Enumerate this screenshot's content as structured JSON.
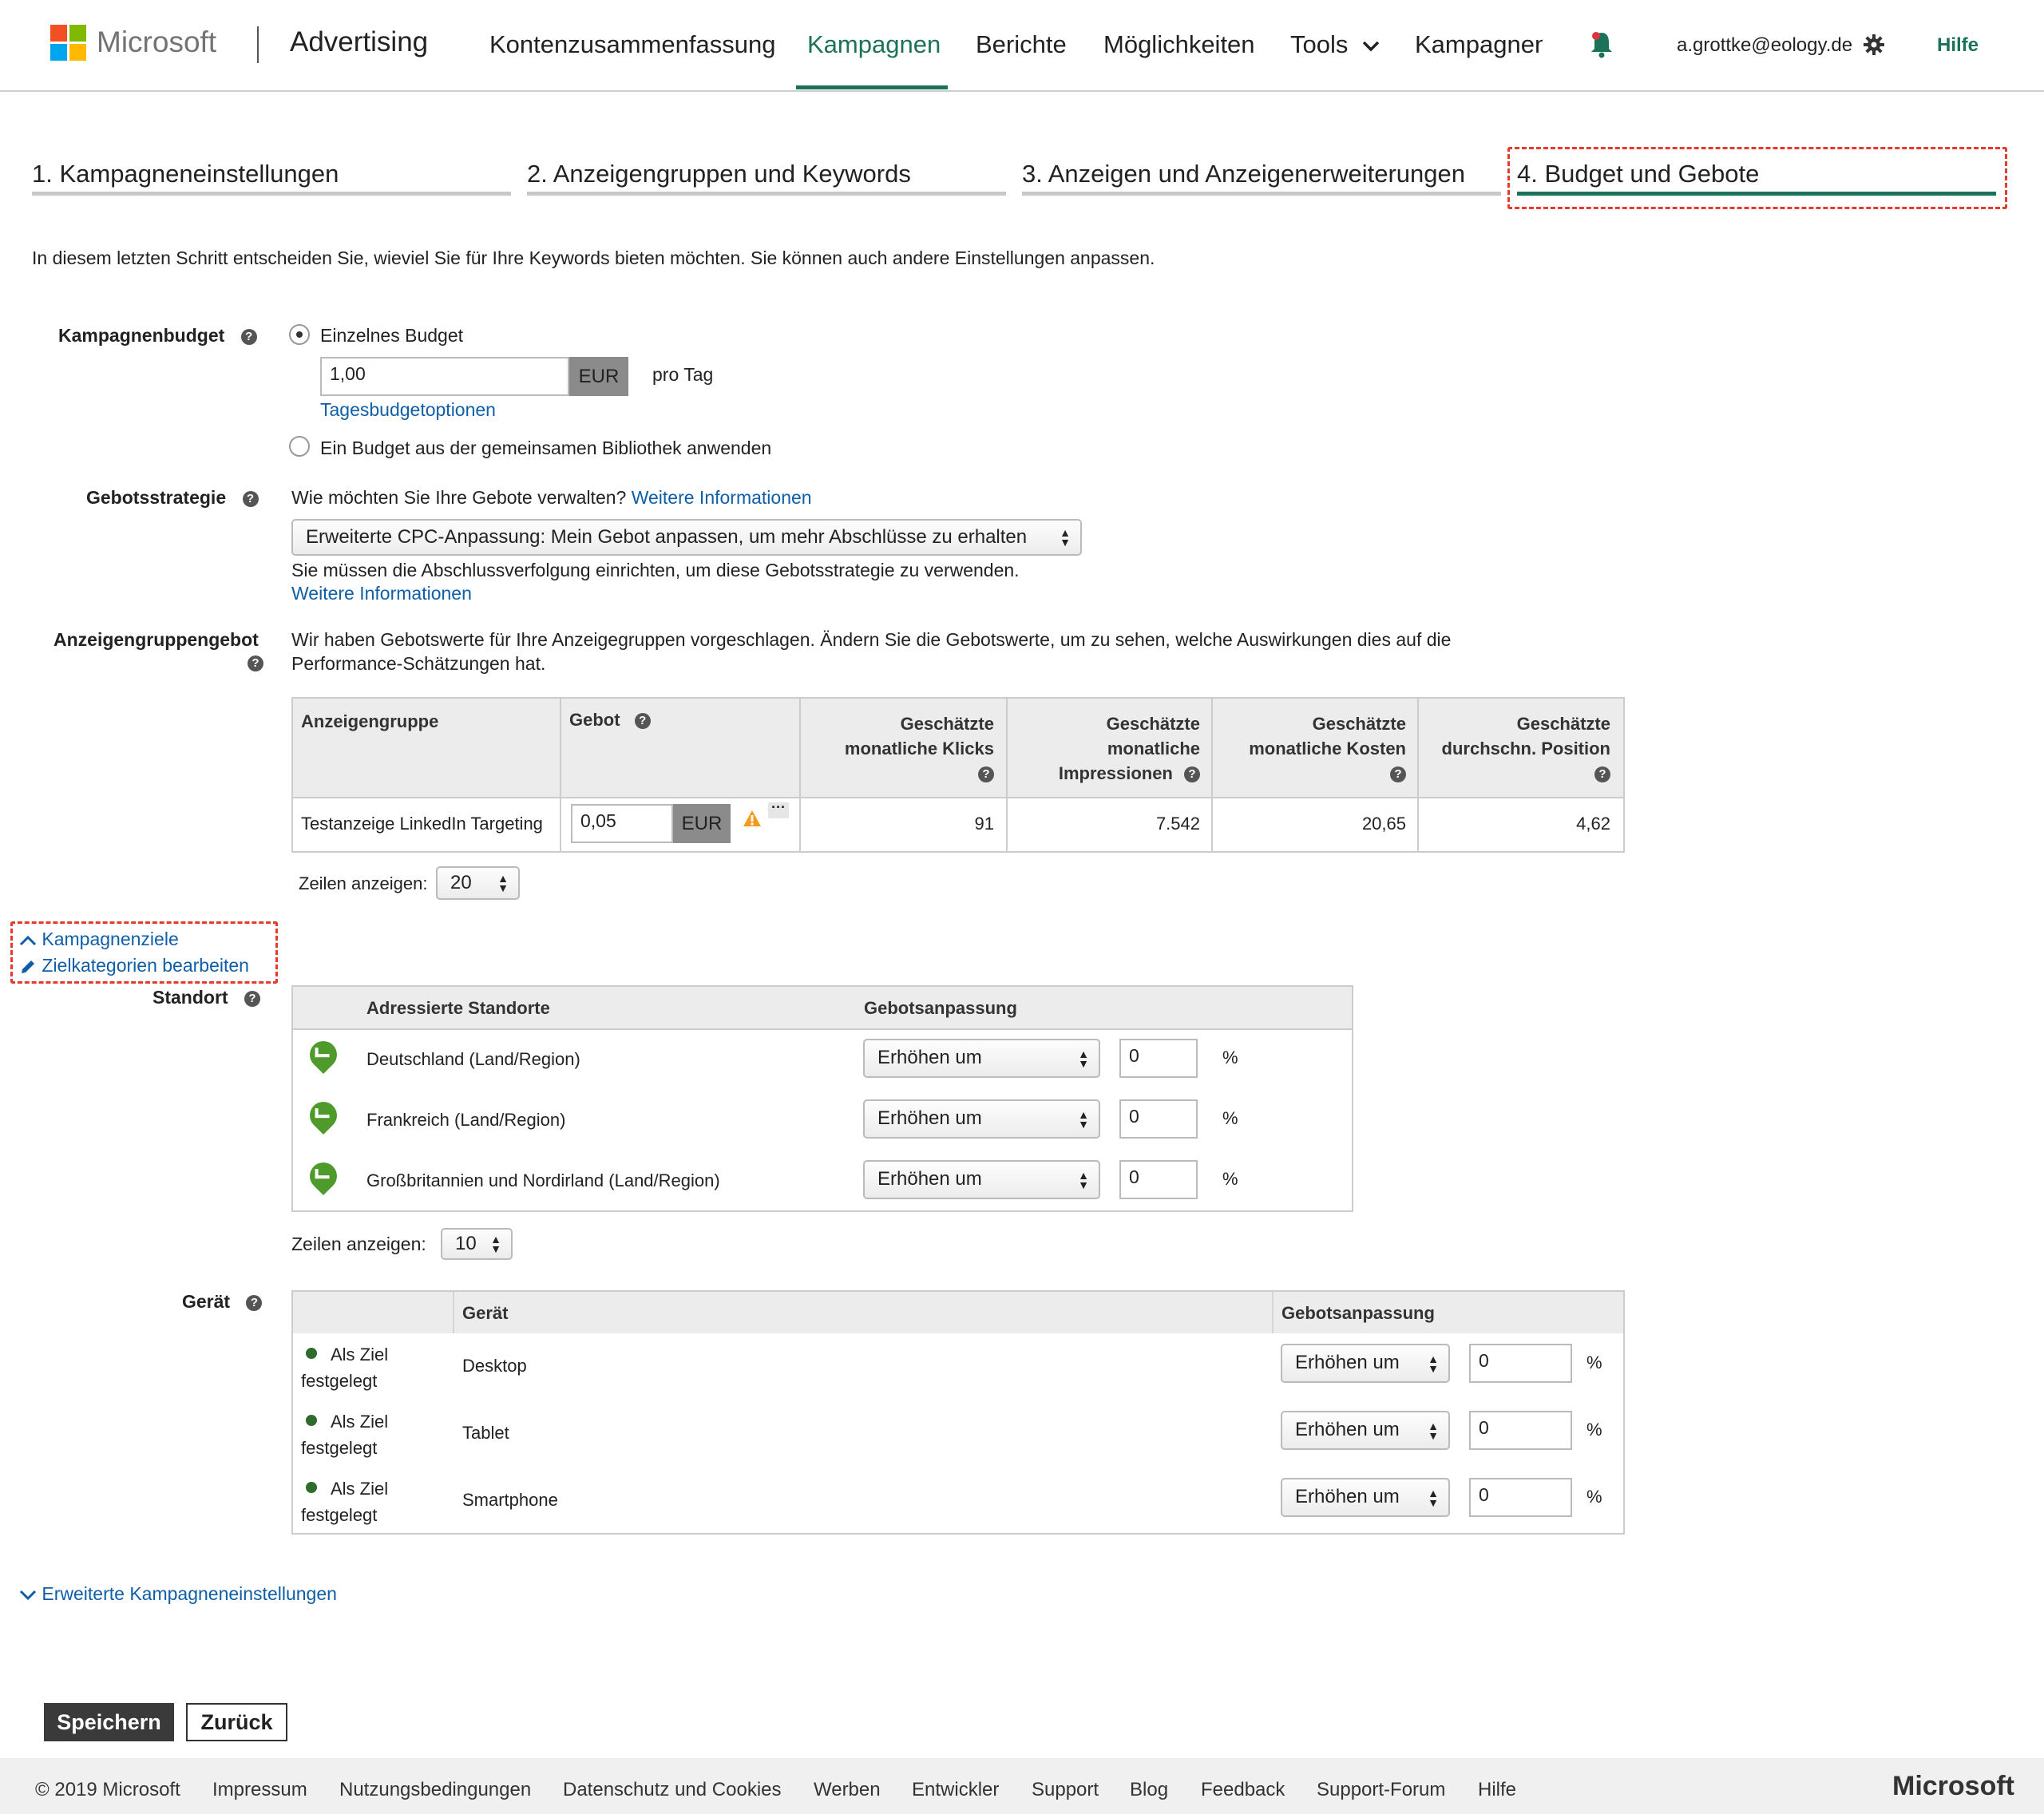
{
  "header": {
    "brand": "Microsoft",
    "product": "Advertising",
    "nav": [
      {
        "label": "Kontenzusammenfassung"
      },
      {
        "label": "Kampagnen"
      },
      {
        "label": "Berichte"
      },
      {
        "label": "Möglichkeiten"
      },
      {
        "label": "Tools"
      },
      {
        "label": "Kampagnen"
      }
    ],
    "user_email": "a.grottke@eology.de",
    "help": "Hilfe"
  },
  "steps": [
    {
      "label": "1. Kampagneneinstellungen"
    },
    {
      "label": "2. Anzeigengruppen und Keywords"
    },
    {
      "label": "3. Anzeigen und Anzeigenerweiterungen"
    },
    {
      "label": "4. Budget und Gebote"
    }
  ],
  "intro": "In diesem letzten Schritt entscheiden Sie, wieviel Sie für Ihre Keywords bieten möchten. Sie können auch andere Einstellungen anpassen.",
  "budget": {
    "label": "Kampagnenbudget",
    "option_single": "Einzelnes Budget",
    "amount": "1,00",
    "currency": "EUR",
    "per_day": "pro Tag",
    "options_link": "Tagesbudgetoptionen",
    "option_library": "Ein Budget aus der gemeinsamen Bibliothek anwenden"
  },
  "bid_strategy": {
    "label": "Gebotsstrategie",
    "question": "Wie möchten Sie Ihre Gebote verwalten?",
    "more_info": "Weitere Informationen",
    "selected": "Erweiterte CPC-Anpassung: Mein Gebot anpassen, um mehr Abschlüsse zu erhalten",
    "note": "Sie müssen die Abschlussverfolgung einrichten, um diese Gebotsstrategie zu verwenden.",
    "more_info2": "Weitere Informationen"
  },
  "adgroup_bid": {
    "label": "Anzeigengruppengebot",
    "desc_line1": "Wir haben Gebotswerte für Ihre Anzeigegruppen vorgeschlagen. Ändern Sie die Gebotswerte, um zu sehen, welche Auswirkungen dies auf die",
    "desc_line2": "Performance-Schätzungen hat.",
    "columns": {
      "group": "Anzeigengruppe",
      "bid": "Gebot",
      "clicks": [
        "Geschätzte",
        "monatliche Klicks"
      ],
      "impressions": [
        "Geschätzte",
        "monatliche",
        "Impressionen"
      ],
      "cost": [
        "Geschätzte",
        "monatliche Kosten"
      ],
      "position": [
        "Geschätzte",
        "durchschn. Position"
      ]
    },
    "row": {
      "group": "Testanzeige LinkedIn Targeting",
      "bid": "0,05",
      "currency": "EUR",
      "clicks": "91",
      "impressions": "7.542",
      "cost": "20,65",
      "position": "4,62"
    },
    "rows_label": "Zeilen anzeigen:",
    "rows_value": "20"
  },
  "targets": {
    "collapse_link": "Kampagnenziele",
    "edit_link": "Zielkategorien bearbeiten"
  },
  "location": {
    "label": "Standort",
    "col_location": "Adressierte Standorte",
    "col_adjust": "Gebotsanpassung",
    "rows": [
      {
        "name": "Deutschland (Land/Region)",
        "mode": "Erhöhen um",
        "value": "0",
        "unit": "%"
      },
      {
        "name": "Frankreich (Land/Region)",
        "mode": "Erhöhen um",
        "value": "0",
        "unit": "%"
      },
      {
        "name": "Großbritannien und Nordirland (Land/Region)",
        "mode": "Erhöhen um",
        "value": "0",
        "unit": "%"
      }
    ],
    "rows_label": "Zeilen anzeigen:",
    "rows_value": "10"
  },
  "device": {
    "label": "Gerät",
    "col_device": "Gerät",
    "col_adjust": "Gebotsanpassung",
    "rows": [
      {
        "status1": "Als Ziel",
        "status2": "festgelegt",
        "name": "Desktop",
        "mode": "Erhöhen um",
        "value": "0",
        "unit": "%"
      },
      {
        "status1": "Als Ziel",
        "status2": "festgelegt",
        "name": "Tablet",
        "mode": "Erhöhen um",
        "value": "0",
        "unit": "%"
      },
      {
        "status1": "Als Ziel",
        "status2": "festgelegt",
        "name": "Smartphone",
        "mode": "Erhöhen um",
        "value": "0",
        "unit": "%"
      }
    ]
  },
  "advanced_link": "Erweiterte Kampagneneinstellungen",
  "buttons": {
    "save": "Speichern",
    "back": "Zurück"
  },
  "footer": {
    "copyright": "© 2019 Microsoft",
    "links": [
      "Impressum",
      "Nutzungsbedingungen",
      "Datenschutz und Cookies",
      "Werben",
      "Entwickler",
      "Support",
      "Blog",
      "Feedback",
      "Support-Forum",
      "Hilfe"
    ],
    "brand": "Microsoft"
  },
  "colors": {
    "accent": "#1c7159",
    "link": "#0f5ea8",
    "annotation": "#e53b2c",
    "save_button": "#3a3a3a"
  }
}
